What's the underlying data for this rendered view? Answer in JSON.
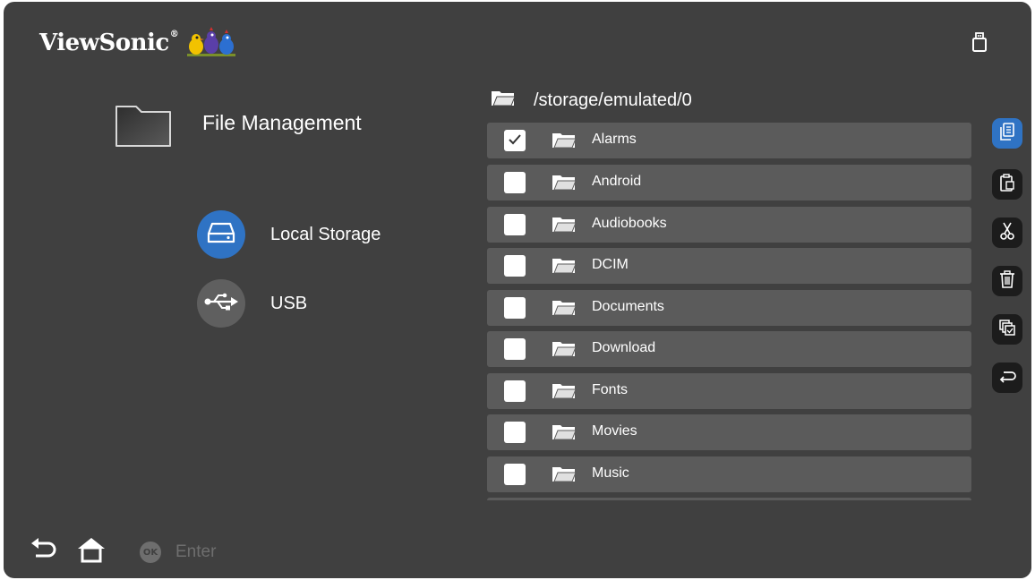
{
  "brand": {
    "name": "ViewSonic",
    "reg": "®"
  },
  "status": {
    "usb_indicator_icon": "usb-stick-icon"
  },
  "app": {
    "title": "File Management",
    "icon": "folder-icon"
  },
  "sources": [
    {
      "label": "Local Storage",
      "icon": "hard-drive-icon",
      "selected": true,
      "color": "#2f73c4"
    },
    {
      "label": "USB",
      "icon": "usb-symbol-icon",
      "selected": false,
      "color": "#5f5f5f"
    }
  ],
  "browser": {
    "path": "/storage/emulated/0",
    "items": [
      {
        "name": "Alarms",
        "checked": true
      },
      {
        "name": "Android",
        "checked": false
      },
      {
        "name": "Audiobooks",
        "checked": false
      },
      {
        "name": "DCIM",
        "checked": false
      },
      {
        "name": "Documents",
        "checked": false
      },
      {
        "name": "Download",
        "checked": false
      },
      {
        "name": "Fonts",
        "checked": false
      },
      {
        "name": "Movies",
        "checked": false
      },
      {
        "name": "Music",
        "checked": false
      }
    ]
  },
  "actions": [
    {
      "name": "copy",
      "icon": "copy-icon",
      "active": true
    },
    {
      "name": "paste",
      "icon": "paste-icon",
      "active": false
    },
    {
      "name": "cut",
      "icon": "scissors-icon",
      "active": false
    },
    {
      "name": "delete",
      "icon": "trash-icon",
      "active": false
    },
    {
      "name": "select-all",
      "icon": "select-all-icon",
      "active": false
    },
    {
      "name": "back",
      "icon": "return-icon",
      "active": false
    }
  ],
  "footer": {
    "ok_badge": "OK",
    "enter_label": "Enter"
  },
  "colors": {
    "background": "#404040",
    "row": "#5b5b5b",
    "accent": "#2f73c4"
  }
}
